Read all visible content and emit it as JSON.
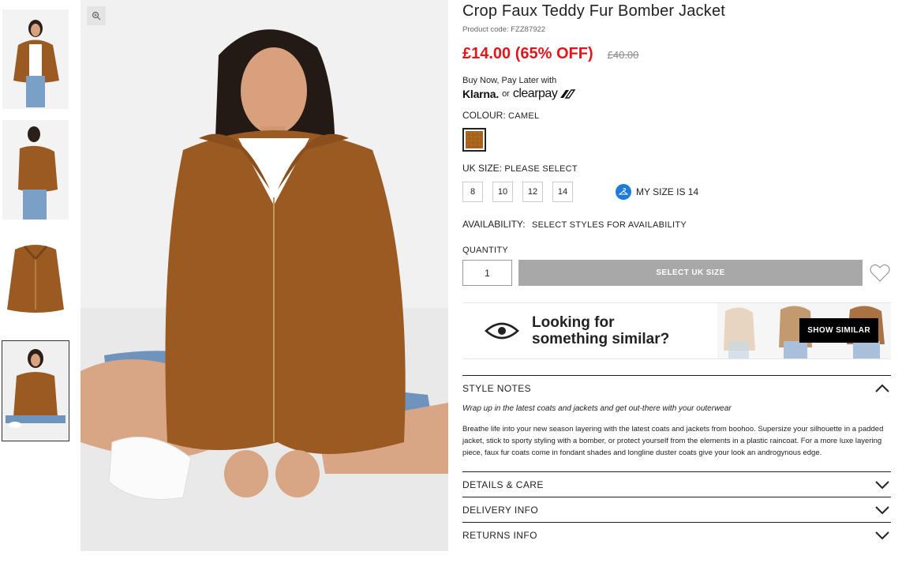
{
  "product": {
    "title": "Crop Faux Teddy Fur Bomber Jacket",
    "code": "Product code: FZZ87922",
    "price_now": "£14.00 (65% OFF)",
    "price_was": "£40.00"
  },
  "bnpl": {
    "text": "Buy Now, Pay Later with",
    "klarna": "Klarna.",
    "or": "or",
    "clearpay": "clearpay"
  },
  "colour": {
    "label": "COLOUR:",
    "value": "CAMEL",
    "swatch_color": "#a8641f"
  },
  "size": {
    "label": "UK SIZE:",
    "value": "PLEASE SELECT",
    "options": [
      "8",
      "10",
      "12",
      "14"
    ],
    "my_size": "MY SIZE IS 14"
  },
  "availability": {
    "label": "AVAILABILITY:",
    "value": "SELECT STYLES FOR AVAILABILITY"
  },
  "quantity": {
    "label": "QUANTITY",
    "value": "1"
  },
  "add_button": "SELECT UK SIZE",
  "similar": {
    "line1": "Looking for",
    "line2": "something similar?",
    "button": "SHOW SIMILAR"
  },
  "accordion": {
    "style_notes": {
      "title": "STYLE NOTES",
      "lead": "Wrap up in the latest coats and jackets and get out-there with your outerwear",
      "text": "Breathe life into your new season layering with the latest coats and jackets from boohoo. Supersize your silhouette in a padded jacket, stick to sporty styling with a bomber, or protect yourself from the elements in a plastic raincoat. For a more luxe layering piece, faux fur coats come in fondant shades and longline duster coats give your look an androgynous edge."
    },
    "details": "DETAILS & CARE",
    "delivery": "DELIVERY INFO",
    "returns": "RETURNS INFO"
  },
  "colors": {
    "sale": "#e0161b",
    "accent": "#1e7bd8",
    "disabled": "#a8a8a8",
    "jacket": "#9a5a22"
  },
  "icons": [
    "zoom-icon",
    "hanger-icon",
    "heart-icon",
    "eye-icon",
    "chevron-up-icon",
    "chevron-down-icon"
  ]
}
